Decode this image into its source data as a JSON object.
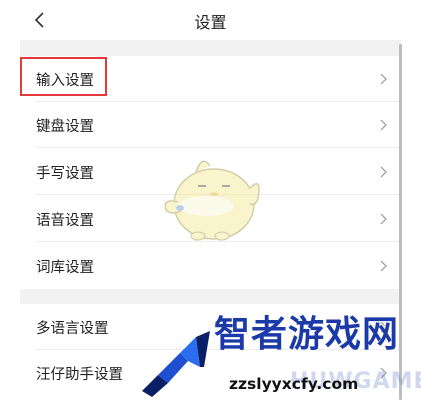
{
  "header": {
    "title": "设置"
  },
  "settings": {
    "items": [
      {
        "label": "输入设置"
      },
      {
        "label": "键盘设置"
      },
      {
        "label": "手写设置"
      },
      {
        "label": "语音设置"
      },
      {
        "label": "词库设置"
      },
      {
        "label": "多语言设置"
      },
      {
        "label": "汪仔助手设置"
      }
    ]
  },
  "watermark": {
    "title": "智者游戏网",
    "url": "zzslyyxcfy.com",
    "ghost_text": "HUWGAME"
  },
  "icons": {
    "back": "chevron-left-icon",
    "row_arrow": "chevron-right-icon",
    "mascot": "mascot-icon",
    "logo": "logo-icon"
  },
  "colors": {
    "highlight_border": "#e33b3b",
    "section_gap": "#f2f2f2",
    "watermark_blue": "#1b3aa8",
    "logo_dark": "#0b1f66",
    "logo_light": "#2a6df0"
  }
}
